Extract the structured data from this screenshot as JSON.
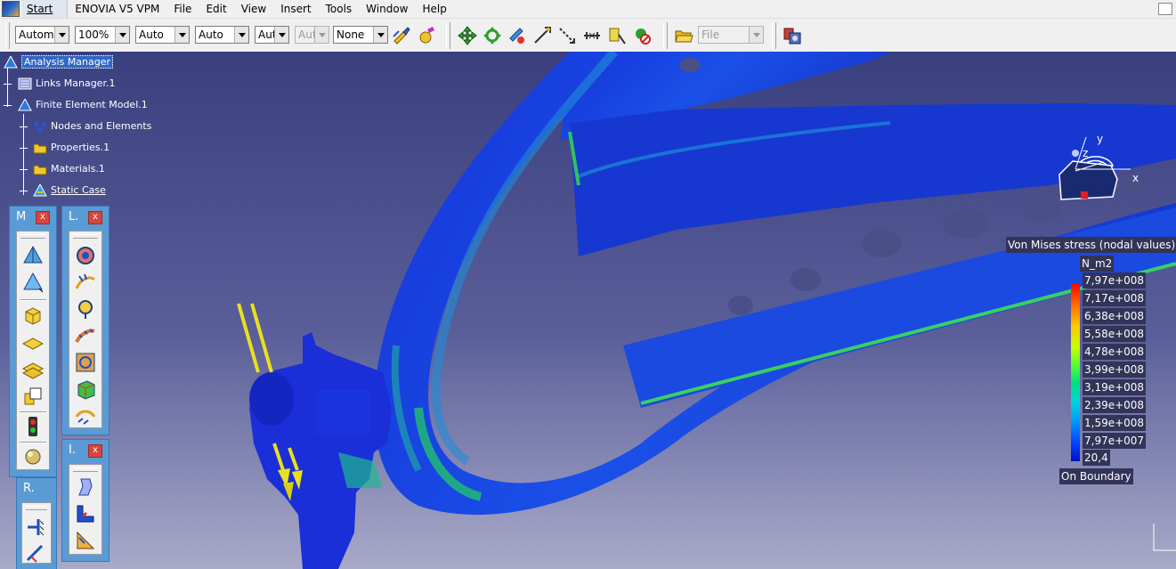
{
  "menu": {
    "start": "Start",
    "app": "ENOVIA V5 VPM",
    "items": [
      "File",
      "Edit",
      "View",
      "Insert",
      "Tools",
      "Window",
      "Help"
    ]
  },
  "toolbar": {
    "combos": [
      "Automa",
      "100%",
      "Auto",
      "Auto",
      "Aut",
      "Aut",
      "None"
    ],
    "file_combo": "File"
  },
  "tree": {
    "root": "Analysis Manager",
    "links": "Links Manager.1",
    "fem": "Finite Element Model.1",
    "nodes": "Nodes and Elements",
    "properties": "Properties.1",
    "materials": "Materials.1",
    "static_case": "Static Case"
  },
  "floating_toolbars": {
    "mesh": {
      "title": "M",
      "close": "x"
    },
    "loads": {
      "title": "L.",
      "close": "x"
    },
    "images": {
      "title": "I.",
      "close": "x"
    },
    "restraints": {
      "title": "R."
    }
  },
  "legend": {
    "title": "Von Mises stress (nodal values)",
    "unit": "N_m2",
    "values": [
      "7,97e+008",
      "7,17e+008",
      "6,38e+008",
      "5,58e+008",
      "4,78e+008",
      "3,99e+008",
      "3,19e+008",
      "2,39e+008",
      "1,59e+008",
      "7,97e+007",
      "20,4"
    ],
    "footer": "On Boundary"
  },
  "compass": {
    "x": "x",
    "y": "y",
    "z": "z"
  },
  "colors": {
    "accent": "#5b9bd5",
    "background_top": "#3a3f7e",
    "selection": "#3168c6"
  }
}
